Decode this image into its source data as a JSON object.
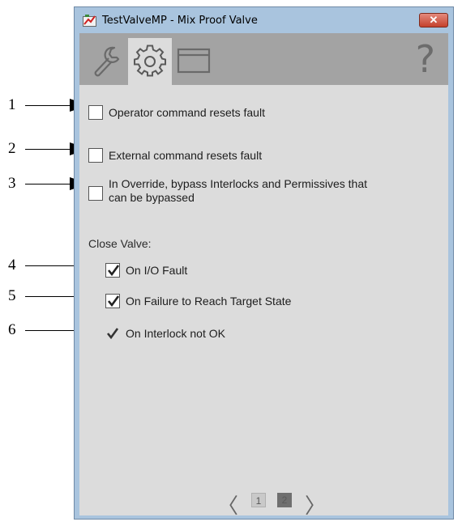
{
  "window": {
    "title": "TestValveMP - Mix Proof Valve",
    "close_symbol": "✕"
  },
  "toolbar": {
    "tabs": [
      {
        "name": "maintenance",
        "icon": "wrench-icon"
      },
      {
        "name": "configuration",
        "icon": "gear-icon",
        "active": true
      },
      {
        "name": "faceplate",
        "icon": "window-icon"
      }
    ],
    "help_symbol": "?"
  },
  "options": [
    {
      "label": "Operator command resets fault",
      "checked": false
    },
    {
      "label": "External command resets fault",
      "checked": false
    },
    {
      "label": "In Override, bypass Interlocks and Permissives that",
      "label_line2": "can be bypassed",
      "checked": false
    }
  ],
  "close_valve": {
    "label": "Close Valve:",
    "items": [
      {
        "label": "On I/O Fault",
        "checked": true
      },
      {
        "label": "On Failure to Reach Target State",
        "checked": true
      },
      {
        "label": "On Interlock not OK",
        "checked": true,
        "disabled": true
      }
    ]
  },
  "callouts": [
    "1",
    "2",
    "3",
    "4",
    "5",
    "6"
  ],
  "pager": {
    "prev": "〈",
    "next": "〉",
    "pages": [
      "1",
      "2"
    ],
    "current": 2
  },
  "colors": {
    "frame": "#a9c4de",
    "client_bg": "#dcdcdc",
    "toolbar_bg": "#a3a3a3",
    "close_red": "#c4412d"
  }
}
